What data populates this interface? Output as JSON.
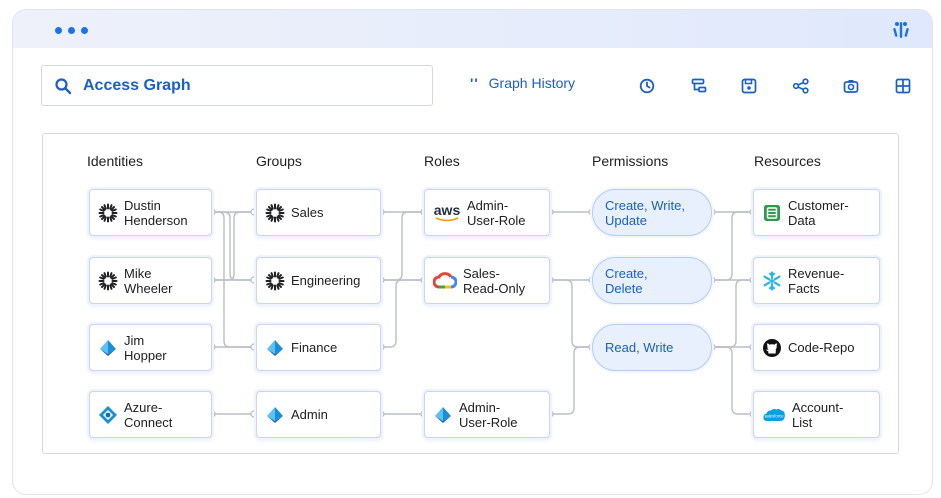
{
  "search": {
    "label": "Access Graph",
    "icon": "search-icon"
  },
  "toolbar": {
    "history_mark": "''",
    "history_label": "Graph History",
    "icons": [
      "history-clock-icon",
      "hierarchy-icon",
      "save-icon",
      "share-icon",
      "camera-icon",
      "grid-icon"
    ]
  },
  "columns": {
    "identities": "Identities",
    "groups": "Groups",
    "roles": "Roles",
    "permissions": "Permissions",
    "resources": "Resources"
  },
  "identities": [
    {
      "label_1": "Dustin",
      "label_2": "Henderson",
      "icon": "sunburst-icon"
    },
    {
      "label_1": "Mike",
      "label_2": "Wheeler",
      "icon": "sunburst-icon"
    },
    {
      "label_1": "Jim",
      "label_2": "Hopper",
      "icon": "azure-ad-icon"
    },
    {
      "label_1": "Azure-",
      "label_2": "Connect",
      "icon": "azure-connect-icon"
    }
  ],
  "groups": [
    {
      "label": "Sales",
      "icon": "sunburst-icon"
    },
    {
      "label": "Engineering",
      "icon": "sunburst-icon"
    },
    {
      "label": "Finance",
      "icon": "azure-ad-icon"
    },
    {
      "label": "Admin",
      "icon": "azure-ad-icon"
    }
  ],
  "roles": [
    {
      "label_1": "Admin-",
      "label_2": "User-Role",
      "icon": "aws-icon",
      "icon_text": "aws"
    },
    {
      "label_1": "Sales-",
      "label_2": "Read-Only",
      "icon": "google-cloud-icon"
    },
    {
      "label_1": "Admin-",
      "label_2": "User-Role",
      "icon": "azure-ad-icon"
    }
  ],
  "permissions": [
    {
      "label_1": "Create, Write,",
      "label_2": "Update"
    },
    {
      "label_1": "Create,",
      "label_2": "Delete"
    },
    {
      "label_1": "Read, Write",
      "label_2": ""
    }
  ],
  "resources": [
    {
      "label_1": "Customer-",
      "label_2": "Data",
      "icon": "database-icon"
    },
    {
      "label_1": "Revenue-",
      "label_2": "Facts",
      "icon": "snowflake-icon"
    },
    {
      "label_1": "Code-Repo",
      "label_2": "",
      "icon": "github-icon"
    },
    {
      "label_1": "Account-",
      "label_2": "List",
      "icon": "salesforce-icon",
      "icon_text": "salesforce"
    }
  ],
  "colors": {
    "accent": "#1a5fc4",
    "dots": "#1a73e8",
    "node_border": "#c8d5f3",
    "permission_fill": "#e9f0fd",
    "wire": "#b9bec7"
  }
}
